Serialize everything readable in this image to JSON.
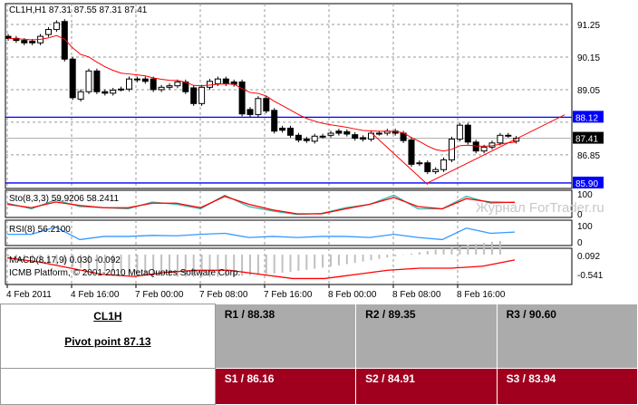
{
  "chart_data": {
    "type": "candlestick",
    "title": "CL1H,H1  87.31 87.55 87.31 87.41",
    "y_ticks": [
      "91.25",
      "90.15",
      "89.05",
      "86.85"
    ],
    "ylim": [
      85.6,
      92.0
    ],
    "levels": [
      {
        "label": "88.12",
        "value": 88.12,
        "color": "#0000ff"
      },
      {
        "label": "85.90",
        "value": 85.9,
        "color": "#0000ff"
      }
    ],
    "current": {
      "label": "87.41",
      "value": 87.41
    },
    "x_ticks": [
      "4 Feb 2011",
      "4 Feb 16:00",
      "7 Feb 00:00",
      "7 Feb 08:00",
      "7 Feb 16:00",
      "8 Feb 00:00",
      "8 Feb 08:00",
      "8 Feb 16:00"
    ],
    "candles": [
      [
        90.85,
        90.78
      ],
      [
        90.78,
        90.71
      ],
      [
        90.71,
        90.63
      ],
      [
        90.68,
        90.63
      ],
      [
        90.63,
        90.85
      ],
      [
        90.91,
        91.08
      ],
      [
        91.08,
        91.31
      ],
      [
        91.35,
        90.08
      ],
      [
        90.08,
        88.78
      ],
      [
        88.73,
        88.98
      ],
      [
        88.98,
        89.68
      ],
      [
        89.68,
        88.98
      ],
      [
        88.98,
        88.93
      ],
      [
        88.93,
        89.03
      ],
      [
        89.07,
        89.07
      ],
      [
        89.07,
        89.41
      ],
      [
        89.41,
        89.38
      ],
      [
        89.41,
        89.33
      ],
      [
        89.41,
        89.05
      ],
      [
        89.05,
        89.13
      ],
      [
        89.13,
        89.18
      ],
      [
        89.18,
        89.31
      ],
      [
        89.31,
        88.98
      ],
      [
        89.11,
        88.58
      ],
      [
        88.58,
        89.13
      ],
      [
        89.13,
        89.33
      ],
      [
        89.25,
        89.41
      ],
      [
        89.41,
        89.25
      ],
      [
        89.31,
        89.23
      ],
      [
        89.31,
        88.23
      ],
      [
        88.38,
        88.21
      ],
      [
        88.21,
        88.75
      ],
      [
        88.75,
        88.33
      ],
      [
        88.35,
        87.65
      ],
      [
        87.75,
        87.68
      ],
      [
        87.75,
        87.51
      ],
      [
        87.51,
        87.35
      ],
      [
        87.38,
        87.33
      ],
      [
        87.31,
        87.48
      ],
      [
        87.48,
        87.48
      ],
      [
        87.51,
        87.58
      ],
      [
        87.65,
        87.58
      ],
      [
        87.63,
        87.55
      ],
      [
        87.53,
        87.41
      ],
      [
        87.43,
        87.38
      ],
      [
        87.38,
        87.58
      ],
      [
        87.58,
        87.58
      ],
      [
        87.58,
        87.65
      ],
      [
        87.65,
        87.58
      ],
      [
        87.58,
        87.33
      ],
      [
        87.35,
        86.53
      ],
      [
        86.58,
        86.55
      ],
      [
        86.58,
        86.28
      ],
      [
        86.28,
        86.35
      ],
      [
        86.35,
        86.68
      ],
      [
        86.68,
        87.38
      ],
      [
        87.38,
        87.85
      ],
      [
        87.85,
        87.28
      ],
      [
        87.28,
        86.98
      ],
      [
        86.98,
        87.11
      ],
      [
        87.11,
        87.25
      ],
      [
        87.25,
        87.51
      ],
      [
        87.51,
        87.51
      ],
      [
        87.31,
        87.41
      ]
    ],
    "trendlines": [
      [
        [
          45,
          87.6
        ],
        [
          52,
          85.85
        ]
      ],
      [
        [
          52,
          85.9
        ],
        [
          69,
          88.2
        ]
      ]
    ],
    "indicators": {
      "sto": {
        "label": "Sto(8,3,3) 59.9206 58.2411",
        "ticks": [
          "100",
          "0"
        ],
        "main": [
          55,
          30,
          70,
          40,
          35,
          30,
          60,
          50,
          30,
          90,
          40,
          20,
          5,
          10,
          35,
          50,
          90,
          30,
          30,
          85,
          55,
          60
        ],
        "signal": [
          50,
          35,
          60,
          45,
          35,
          35,
          55,
          55,
          35,
          85,
          50,
          25,
          8,
          8,
          30,
          50,
          80,
          40,
          30,
          75,
          60,
          58
        ]
      },
      "rsi": {
        "label": "RSI(8) 56.2100",
        "ticks": [
          "100",
          "0"
        ],
        "values": [
          45,
          45,
          80,
          20,
          35,
          35,
          40,
          38,
          45,
          50,
          30,
          35,
          30,
          35,
          35,
          30,
          45,
          30,
          20,
          75,
          50,
          56
        ]
      },
      "macd": {
        "label": "MACD(8,17,9) 0.030 -0.092",
        "ticks": [
          "0.092",
          "-0.541"
        ],
        "signal": [
          0.0,
          -0.1,
          -0.25,
          -0.4,
          -0.45,
          -0.35,
          -0.3,
          -0.3,
          -0.4,
          -0.5,
          -0.5,
          -0.4,
          -0.3,
          -0.25,
          -0.25,
          -0.2,
          -0.05
        ]
      }
    },
    "copyright": "ICMB Platform, © 2001-2010 MetaQuotes Software Corp.",
    "watermark": "Журнал ForTrader.ru"
  },
  "pivot": {
    "symbol": "CL1H",
    "pivot": "Pivot point 87.13",
    "r1": "R1 / 88.38",
    "r2": "R2 / 89.35",
    "r3": "R3 / 90.60",
    "s1": "S1 / 86.16",
    "s2": "S2 / 84.91",
    "s3": "S3 / 83.94"
  }
}
